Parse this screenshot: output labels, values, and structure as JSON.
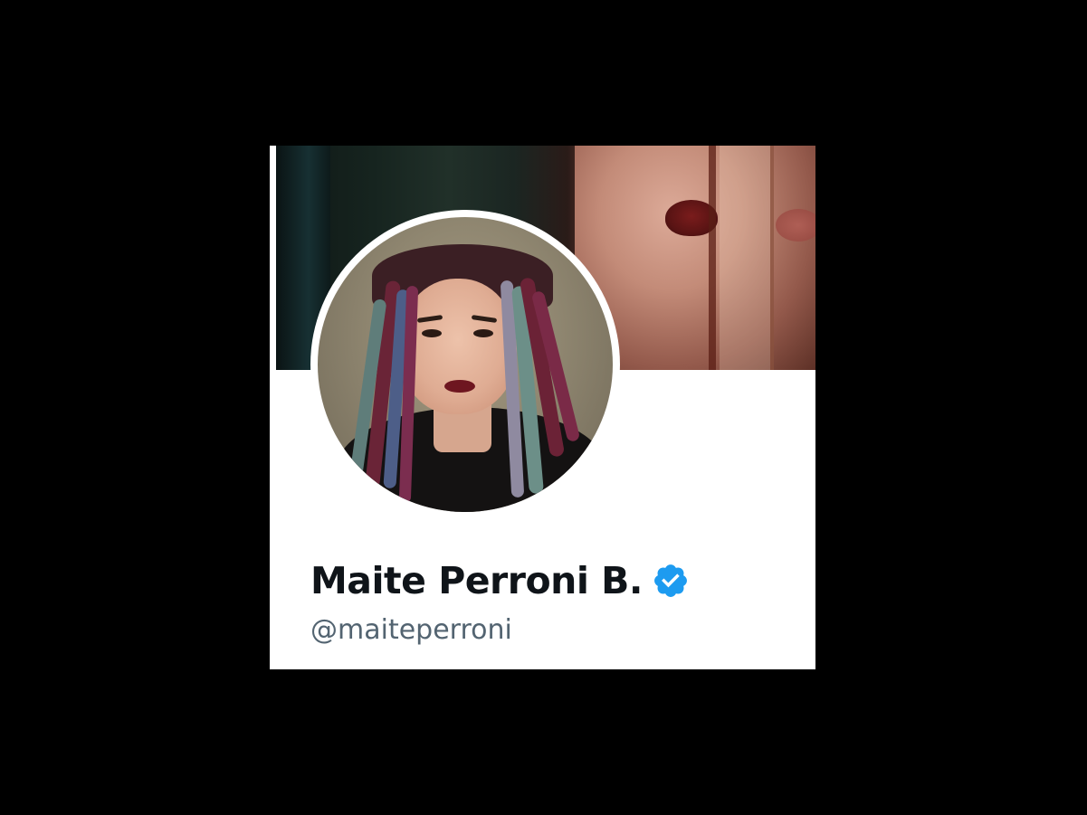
{
  "profile": {
    "display_name": "Maite Perroni B.",
    "handle": "@maiteperroni",
    "verified": true
  },
  "images": {
    "banner": "header-banner-photo",
    "avatar": "profile-avatar-photo"
  },
  "icons": {
    "verified": "verified-badge-icon"
  },
  "colors": {
    "background": "#000000",
    "card": "#ffffff",
    "name_text": "#0f1419",
    "handle_text": "#536471",
    "verified_blue": "#1d9bf0"
  }
}
